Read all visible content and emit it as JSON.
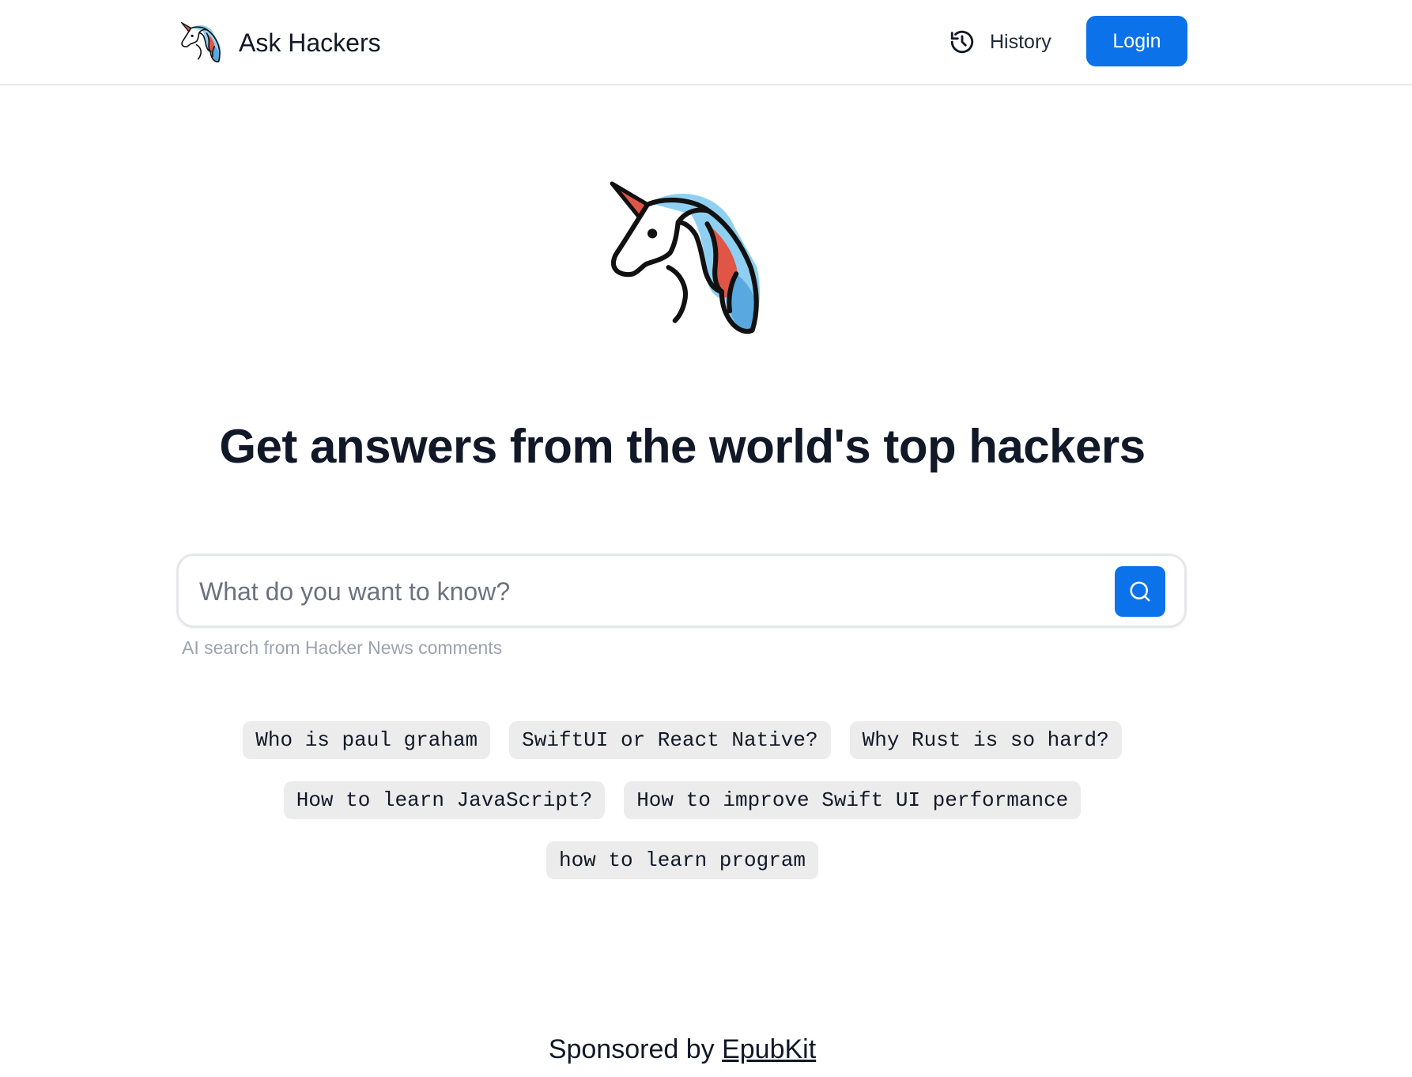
{
  "header": {
    "brand_name": "Ask Hackers",
    "history_label": "History",
    "login_label": "Login"
  },
  "hero": {
    "headline": "Get answers from the world's top hackers"
  },
  "search": {
    "placeholder": "What do you want to know?",
    "value": "",
    "caption": "AI search from Hacker News comments"
  },
  "suggestions": [
    "Who is paul graham",
    "SwiftUI or React Native?",
    "Why Rust is so hard?",
    "How to learn JavaScript?",
    "How to improve Swift UI performance",
    "how to learn program"
  ],
  "footer": {
    "sponsor_prefix": "Sponsored by",
    "sponsor_link": "EpubKit"
  },
  "colors": {
    "accent": "#0b72ea",
    "chip_bg": "#ececec",
    "mane_light_blue": "#8fd0f2",
    "mane_red": "#e05545",
    "mane_blue": "#5aa8e0"
  },
  "icons": {
    "logo": "unicorn-icon",
    "history": "history-clock-icon",
    "search": "search-icon"
  }
}
